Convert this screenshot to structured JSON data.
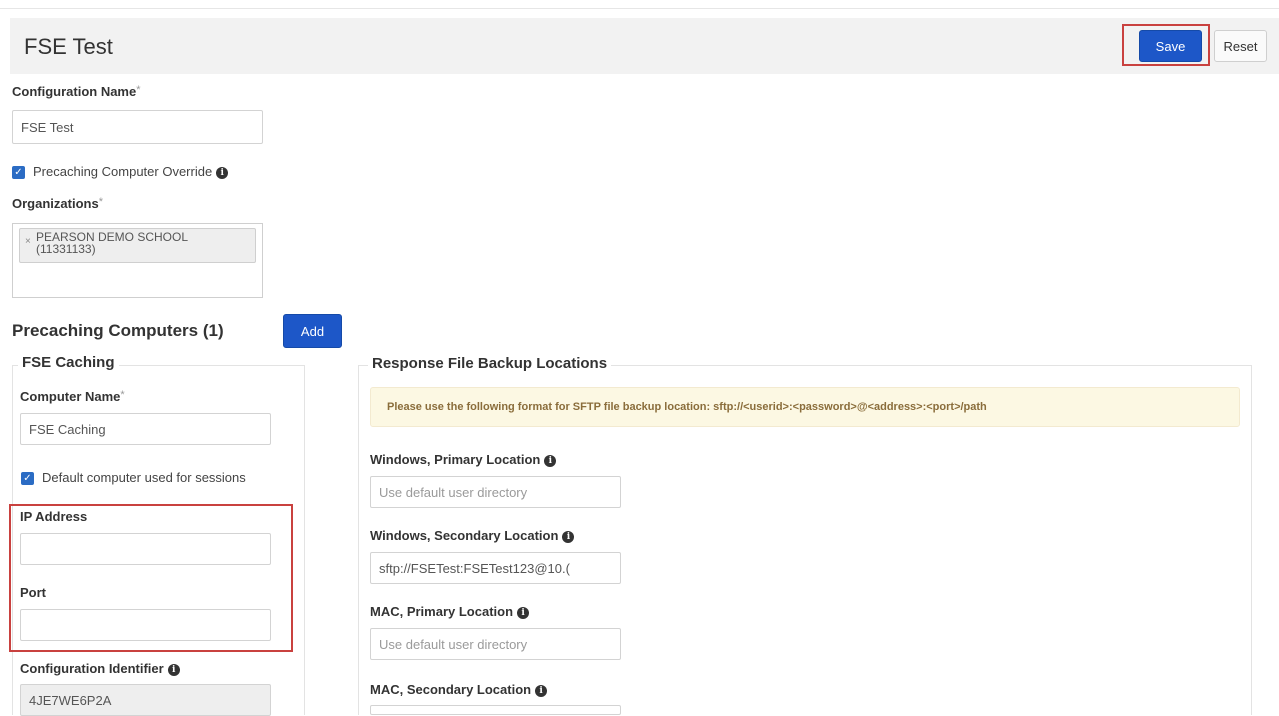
{
  "header": {
    "title": "FSE Test",
    "save_label": "Save",
    "reset_label": "Reset"
  },
  "config": {
    "name_label": "Configuration Name",
    "required_mark": "*",
    "name_value": "FSE Test",
    "override_label": "Precaching Computer Override",
    "override_checked": true,
    "organizations_label": "Organizations",
    "org_tag_remove": "×",
    "org_tag_line1": "PEARSON DEMO SCHOOL",
    "org_tag_line2": "(11331133)"
  },
  "precaching": {
    "title": "Precaching Computers (1)",
    "add_label": "Add"
  },
  "computer": {
    "legend": "FSE Caching",
    "name_label": "Computer Name",
    "name_value": "FSE Caching",
    "default_label": "Default computer used for sessions",
    "default_checked": true,
    "ip_label": "IP Address",
    "ip_value": "",
    "port_label": "Port",
    "port_value": "",
    "config_id_label": "Configuration Identifier",
    "config_id_value": "4JE7WE6P2A"
  },
  "backup": {
    "legend": "Response File Backup Locations",
    "alert": "Please use the following format for SFTP file backup location: sftp://<userid>:<password>@<address>:<port>/path",
    "win_primary_label": "Windows, Primary Location",
    "win_primary_placeholder": "Use default user directory",
    "win_secondary_label": "Windows, Secondary Location",
    "win_secondary_value": "sftp://FSETest:FSETest123@10.(",
    "mac_primary_label": "MAC, Primary Location",
    "mac_primary_placeholder": "Use default user directory",
    "mac_secondary_label": "MAC, Secondary Location",
    "mac_secondary_value": ""
  },
  "icons": {
    "info": "i",
    "check": "✓"
  },
  "colors": {
    "primary": "#1d57c8",
    "highlight": "#c9413f",
    "alert_bg": "#fcf8e3",
    "alert_text": "#8a6d3b"
  }
}
